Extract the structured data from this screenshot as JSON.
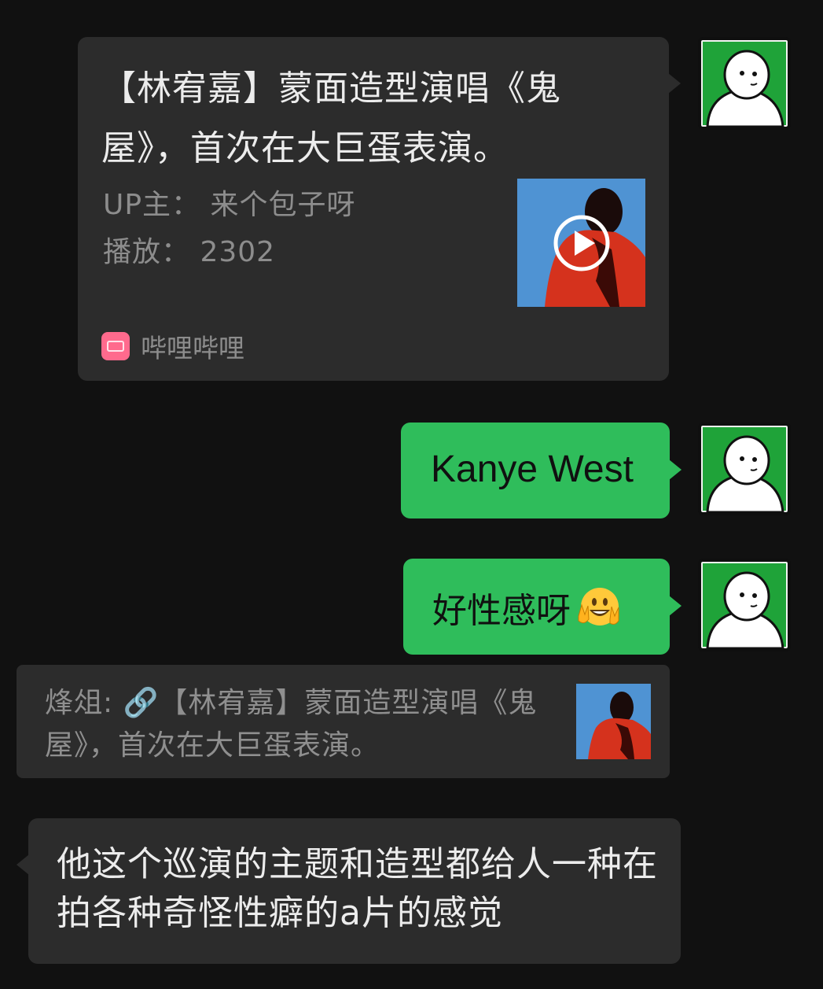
{
  "messages": {
    "link_card": {
      "title": "【林宥嘉】蒙面造型演唱《鬼屋》，首次在大巨蛋表演。",
      "uploader": "UP主：  来个包子呀",
      "plays": "播放：  2302",
      "source": "哔哩哔哩"
    },
    "reply_1": {
      "text": "Kanye West"
    },
    "reply_2": {
      "text": "好性感呀",
      "emoji": "grinning-face-with-peace-hands"
    },
    "quote": {
      "text": "烽俎: 🔗【林宥嘉】蒙面造型演唱《鬼屋》，首次在大巨蛋表演。"
    },
    "incoming": {
      "text": "他这个巡演的主题和造型都给人一种在拍各种奇怪性癖的a片的感觉"
    }
  },
  "colors": {
    "background": "#111111",
    "bubble_dark": "#2c2c2c",
    "bubble_green": "#2fbd5b",
    "avatar_green": "#1fa339",
    "muted_text": "#8d8d8d"
  },
  "icons": [
    "avatar-person-icon",
    "play-icon",
    "bilibili-logo-icon",
    "link-icon",
    "peace-emoji-icon"
  ]
}
